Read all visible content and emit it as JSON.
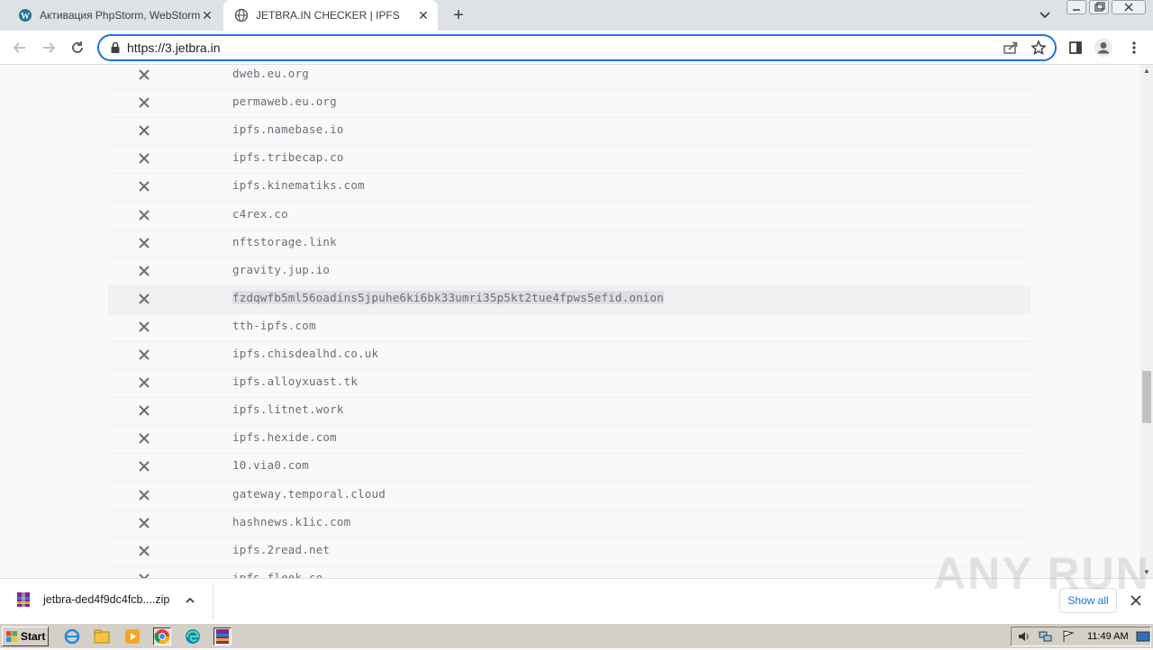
{
  "browser": {
    "tabs": [
      {
        "title": "Активация PhpStorm, WebStorm, In",
        "active": false
      },
      {
        "title": "JETBRA.IN CHECKER | IPFS",
        "active": true
      }
    ],
    "url": "https://3.jetbra.in"
  },
  "hosts": [
    "dweb.eu.org",
    "permaweb.eu.org",
    "ipfs.namebase.io",
    "ipfs.tribecap.co",
    "ipfs.kinematiks.com",
    "c4rex.co",
    "nftstorage.link",
    "gravity.jup.io",
    "fzdqwfb5ml56oadins5jpuhe6ki6bk33umri35p5kt2tue4fpws5efid.onion",
    "tth-ipfs.com",
    "ipfs.chisdealhd.co.uk",
    "ipfs.alloyxuast.tk",
    "ipfs.litnet.work",
    "ipfs.hexide.com",
    "10.via0.com",
    "gateway.temporal.cloud",
    "hashnews.k1ic.com",
    "ipfs.2read.net",
    "ipfs.fleek.co"
  ],
  "highlighted_index": 8,
  "download": {
    "filename": "jetbra-ded4f9dc4fcb....zip",
    "show_all": "Show all"
  },
  "watermark": "ANY RUN",
  "taskbar": {
    "start": "Start",
    "clock": "11:49 AM"
  },
  "icons": {
    "status": "x-icon"
  }
}
